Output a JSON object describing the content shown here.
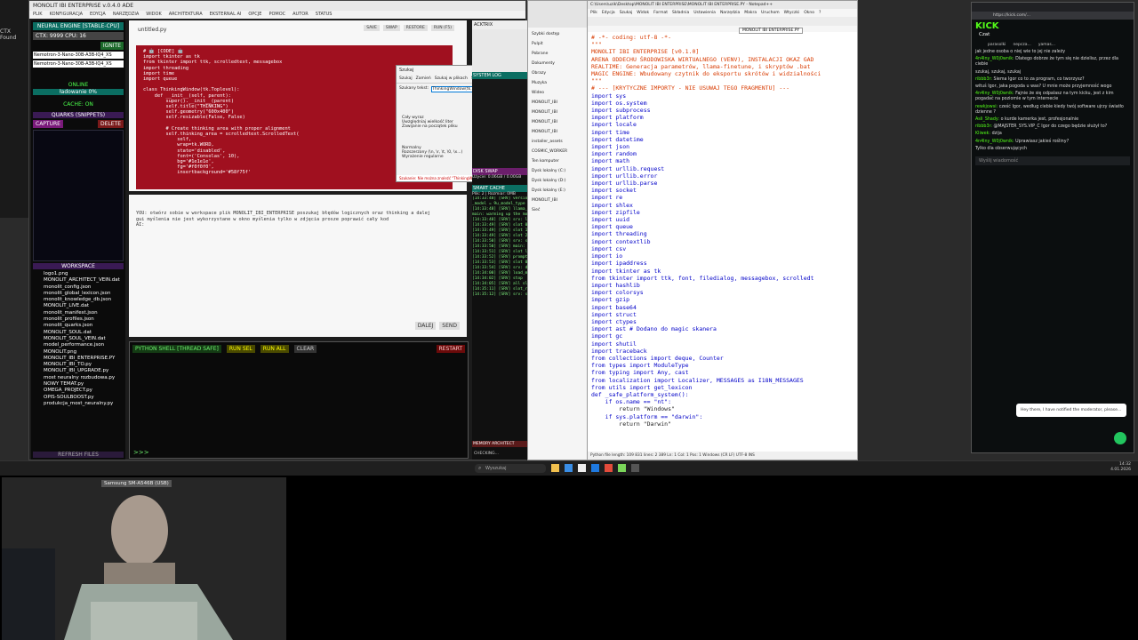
{
  "left_edge": {
    "lines": [
      "CTX",
      "Found"
    ]
  },
  "main_app": {
    "title": "MONOLIT IBI ENTERPRISE v.0.4.0 ADE",
    "menu": [
      "PLIK",
      "KONFIGURACJA",
      "EDYCJA",
      "NARZĘDZIA",
      "WIDOK",
      "ARCHITEKTURA",
      "EKSTERNAL AI",
      "OPCJE",
      "POMOC",
      "AUTOR",
      "STATUS"
    ],
    "neural_title": "NEURAL ENGINE [STABLE-CPU]",
    "ctx_label": "CTX: 9999 CPU: 16",
    "ignite": "IGNITE",
    "model1": "Nemotron-3-Nano-30B-A3B-IQ4_XS",
    "model2": "Nemotron-3-Nano-30B-A3B-IQ4_XS",
    "online": "ONLINE",
    "loading": "ładowanie 0%",
    "cache": "CACHE: ON",
    "quarks": "QUARKS (SNIPPETS)",
    "capture": "CAPTURE",
    "delete": "DELETE",
    "workspace": "WORKSPACE",
    "files": [
      "logo1.png",
      "MONOLIT_ARCHITECT_VEIN.dat",
      "monolit_config.json",
      "monolit_global_lexicon.json",
      "monolit_knowledge_db.json",
      "MONOLIT_LIVE.dat",
      "monolit_manifest.json",
      "monolit_profiles.json",
      "monolit_quarks.json",
      "MONOLIT_SOUL.dat",
      "MONOLIT_SOUL_VEIN.dat",
      "model_performance.json",
      "MONOLIT.png",
      "MONOLIT_IBI_ENTERPRISE.PY",
      "MONOLIT_IBI_TO.py",
      "MONOLIT_IBI_UPGRADE.py",
      "most neuralny rozbudowa.py",
      "NOWY TEMAT.py",
      "OMEGA_PROJECT.py",
      "OPIS-SOULBOOST.py",
      "produkcja_most_neuralny.py"
    ],
    "refresh": "REFRESH FILES",
    "editor_tab": "untitled.py",
    "editor_buttons": [
      "SAVE",
      "SWAP",
      "RESTORE",
      "RUN (F5)"
    ],
    "editor_code": "# 🤖 [CODE] 🤖\nimport tkinter as tk\nfrom tkinter import ttk, scrolledtext, messagebox\nimport threading\nimport time\nimport queue\n\nclass ThinkingWindow(tk.Toplevel):\n    def __init__(self, parent):\n        super().__init__(parent)\n        self.title(\"THINKING\")\n        self.geometry(\"600x400\")\n        self.resizable(False, False)\n\n        # Create thinking area with proper alignment\n        self.thinking_area = scrolledtext.ScrolledText(\n            self,\n            wrap=tk.WORD,\n            state='disabled',\n            font=('Consolas', 10),\n            bg='#1e1e1e',\n            fg='#f0f0f0',\n            insertbackground='#58f75f'",
    "dialog_title": "Szukaj",
    "dialog_tabs": [
      "Szukaj",
      "Zamień",
      "Szukaj w plikach",
      "Szukaj w projekcie",
      "Oznacz"
    ],
    "dialog_label": "Szukany tekst:",
    "dialog_value": "ThinkingWindow(tk.Toplevel)",
    "dialog_buttons": [
      "Znajdź następny",
      "Policz wystąpienia",
      "Znajdź w obecnym dokumencie",
      "Znajdź we wszystkich otwartych dokumentach",
      "Zamknij"
    ],
    "dialog_options": [
      "Cały wyraz",
      "Uwzględniaj wielkość liter",
      "Zawijanie na początek pliku"
    ],
    "dialog_modes": [
      "Normalny",
      "Rozszerzony (\\n, \\r, \\t, \\0, \\x...)",
      "Wyrażenie regularne"
    ],
    "dialog_status": "Szukanie: Nie można znaleźć \"ThinkingWindow(tk.Toplevel)\". Ta sekcja jest pusta.",
    "prompt_text": "YOU: otwórz sobie w workspace plik MONOLIT_IBI_ENTERPRISE poszukaj błędów logicznych oraz thinking a dalej\ngui myślenia nie jest wykorzystane w okno myślenia tylko w zdjęcia prosze poprawić cały kod\nAI:",
    "prompt_buttons": [
      "DALEJ",
      "SEND"
    ],
    "shell_title": "PYTHON SHELL [THREAD SAFE]",
    "shell_buttons": [
      "RUN SEL",
      "RUN ALL",
      "CLEAR"
    ],
    "shell_restart": "RESTART",
    "shell_prompt": ">>>",
    "right_top": "ACKTRIX",
    "system_log": "SYSTEM LOG",
    "disk_swap": "DISK SWAP",
    "swap_info": "Użycie: 0.06GB / 0.00GB",
    "smart_cache": "SMART CACHE",
    "cache_info": "Plik: 2 | Rozmiar: 0MB",
    "log_lines": [
      "[14:33:48] [SRV] version:",
      "_model = 9u_model_type",
      "[14:33:48] [SRV] llama_init:",
      "main: warming up the model",
      "[14:33:48] [SRV] srv: load",
      "[14:33:49] [SRV] slot 0 t",
      "[14:33:49] [SRV] slot 1 t",
      "[14:33:49] [SRV] slot 2 t",
      "[14:33:50] [SRV] srv: server",
      "[14:33:50] [SRV] main: HTTP",
      "[14:33:51] [SRV] slot launch",
      "[14:33:52] [SRV] prompt",
      "[14:33:53] [SRV] slot 0 | task",
      "[14:33:54] [SRV] srv: done",
      "[14:34:00] [SRV] load_model",
      "[14:34:02] [SRV] stop",
      "[14:34:05] [SRV] all slots idle",
      "[14:35:11] [SRV] slot_release",
      "[14:35:12] [SRV] srv: stop"
    ],
    "memory_arch": "MEMORY ARCHITECT",
    "memory_status": "CHECKING..."
  },
  "explorer": {
    "items": [
      "Szybki dostęp",
      "Pulpit",
      "Pobrane",
      "Dokumenty",
      "Obrazy",
      "Muzyka",
      "Wideo",
      "MONOLIT_IBI",
      "MONOLIT_IBI",
      "MONOLIT_IBI",
      "MONOLIT_IBI",
      "installer_assets",
      "COSMIC_WORKER",
      "Ten komputer",
      "Dysk lokalny (C:)",
      "Dysk lokalny (D:)",
      "Dysk lokalny (E:)",
      "MONOLIT_IBI",
      "Sieć"
    ]
  },
  "code_window": {
    "title": "C:\\Users\\uzik\\Desktop\\MONOLIT IBI ENTERPRISE\\MONOLIT IBI ENTERPRISE.PY - Notepad++",
    "menu": [
      "Plik",
      "Edycja",
      "Szukaj",
      "Widok",
      "Format",
      "Składnia",
      "Ustawienia",
      "Narzędzia",
      "Makra",
      "Uruchom",
      "Wtyczki",
      "Okno",
      "?"
    ],
    "tab": "MONOLIT IBI ENTERPRISE.PY",
    "lines": [
      {
        "t": "# -*- coding: utf-8 -*-",
        "c": "cm"
      },
      {
        "t": "\"\"\"",
        "c": "cm"
      },
      {
        "t": "MONOLIT IBI ENTERPRISE [v0.1.0]",
        "c": "cm"
      },
      {
        "t": "ARENA ODDECHU ŚRODOWISKA WIRTUALNEGO (VENV), INSTALACJI OKAZ GAD",
        "c": "cm"
      },
      {
        "t": "REALTIME: Generacja parametrów, llama-finetune, i skryptów .bat",
        "c": "cm"
      },
      {
        "t": "MAGIC ENGINE: Wbudowany czytnik do eksportu skrótów i widzialności",
        "c": "cm"
      },
      {
        "t": "\"\"\"",
        "c": "cm"
      },
      {
        "t": "",
        "c": ""
      },
      {
        "t": "# --- [KRYTYCZNE IMPORTY - NIE USUWAJ TEGO FRAGMENTU] ---",
        "c": "cm"
      },
      {
        "t": "import sys",
        "c": "kw"
      },
      {
        "t": "import os.system",
        "c": "kw"
      },
      {
        "t": "import subprocess",
        "c": "kw"
      },
      {
        "t": "import platform",
        "c": "kw"
      },
      {
        "t": "import locale",
        "c": "kw"
      },
      {
        "t": "import time",
        "c": "kw"
      },
      {
        "t": "import datetime",
        "c": "kw"
      },
      {
        "t": "import json",
        "c": "kw"
      },
      {
        "t": "import random",
        "c": "kw"
      },
      {
        "t": "import math",
        "c": "kw"
      },
      {
        "t": "import urllib.request",
        "c": "kw"
      },
      {
        "t": "import urllib.error",
        "c": "kw"
      },
      {
        "t": "import urllib.parse",
        "c": "kw"
      },
      {
        "t": "import socket",
        "c": "kw"
      },
      {
        "t": "import re",
        "c": "kw"
      },
      {
        "t": "import shlex",
        "c": "kw"
      },
      {
        "t": "import zipfile",
        "c": "kw"
      },
      {
        "t": "import uuid",
        "c": "kw"
      },
      {
        "t": "import queue",
        "c": "kw"
      },
      {
        "t": "import threading",
        "c": "kw"
      },
      {
        "t": "import contextlib",
        "c": "kw"
      },
      {
        "t": "import csv",
        "c": "kw"
      },
      {
        "t": "import io",
        "c": "kw"
      },
      {
        "t": "import ipaddress",
        "c": "kw"
      },
      {
        "t": "import tkinter as tk",
        "c": "kw"
      },
      {
        "t": "from tkinter import ttk, font, filedialog, messagebox, scrolledt",
        "c": "kw"
      },
      {
        "t": "import hashlib",
        "c": "kw"
      },
      {
        "t": "import colorsys",
        "c": "kw"
      },
      {
        "t": "import gzip",
        "c": "kw"
      },
      {
        "t": "import base64",
        "c": "kw"
      },
      {
        "t": "import struct",
        "c": "kw"
      },
      {
        "t": "import ctypes",
        "c": "kw"
      },
      {
        "t": "import ast # Dodano do magic skanera",
        "c": "kw"
      },
      {
        "t": "import gc",
        "c": "kw"
      },
      {
        "t": "import shutil",
        "c": "kw"
      },
      {
        "t": "import traceback",
        "c": "kw"
      },
      {
        "t": "from collections import deque, Counter",
        "c": "kw"
      },
      {
        "t": "from types import ModuleType",
        "c": "kw"
      },
      {
        "t": "from typing import Any, cast",
        "c": "kw"
      },
      {
        "t": "from localization import Localizer, MESSAGES as I18N_MESSAGES",
        "c": "kw"
      },
      {
        "t": "from utils import get_lexicon",
        "c": "kw"
      },
      {
        "t": "",
        "c": ""
      },
      {
        "t": "def _safe_platform_system():",
        "c": "kw"
      },
      {
        "t": "    if os.name == \"nt\":",
        "c": "kw"
      },
      {
        "t": "        return \"Windows\"",
        "c": ""
      },
      {
        "t": "    if sys.platform == \"darwin\":",
        "c": "kw"
      },
      {
        "t": "        return \"Darwin\"",
        "c": ""
      }
    ],
    "status": "Python file    length: 109 831  lines: 2 389    Ln: 1   Col: 1   Pos: 1    Windows (CR LF)   UTF-8   INS"
  },
  "chat": {
    "url": "https://kick.com/...",
    "logo": "KICK",
    "header": "Czat",
    "pinned": [
      "parasolki",
      "nepcza...",
      "yamas..."
    ],
    "messages": [
      {
        "u": "",
        "t": "jak jedne osoba o niej wie to jej nie zależy"
      },
      {
        "u": "4n4lny_W0j0wnik:",
        "t": "Dlatego dobrze że tym się nie dzielisz, przez dla ciebie"
      },
      {
        "u": "",
        "t": "szukaj, szukaj, szukaj"
      },
      {
        "u": "ribbb3r:",
        "t": "Siema Igor co to za program, co tworzysz?"
      },
      {
        "u": "",
        "t": "wituś Igor, jaka pogoda u was? U mnie może przyjemność wogo"
      },
      {
        "u": "4n4lny_W0j0wnik:",
        "t": "Fajnie że się odpalasz na tym kicku, jest z kim pogadać na poziomie w tym internecie"
      },
      {
        "u": "rewkjowsi:",
        "t": "cześć Igor, według ciebie kiedy twój software ujrzy światło dzienne ?"
      },
      {
        "u": "Asli_Shady:",
        "t": "o kurde kamerka jest, profesjonalnie"
      },
      {
        "u": "ribbb3r:",
        "t": "@MAJSTER_SYS.VIP_C Igor do czego będzie służył to?"
      },
      {
        "u": "Kliwek:",
        "t": "dzija"
      },
      {
        "u": "4n4lny_W0j0wnik:",
        "t": "Uprawiasz jakieś rośliny?"
      },
      {
        "u": "",
        "t": "Tylko dla obserwujących"
      }
    ],
    "input_placeholder": "Wyślij wiadomość",
    "notice": "Hey there, I have notified the moderator, please..."
  },
  "taskbar": {
    "search": "Wyszukaj",
    "time": "14:32",
    "date": "4.01.2026"
  },
  "webcam": {
    "label": "Samsung SM-A546B (USB)"
  }
}
